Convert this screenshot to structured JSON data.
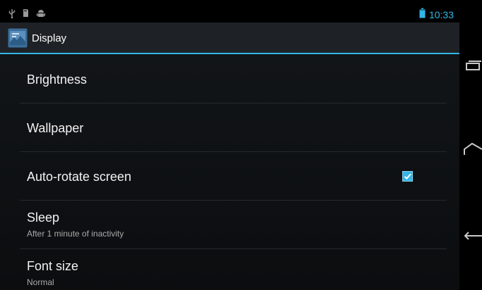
{
  "status_bar": {
    "icons": [
      "usb-icon",
      "sd-card-icon",
      "android-debug-icon"
    ],
    "battery_icon": "battery-icon",
    "time": "10:33"
  },
  "action_bar": {
    "app_icon": "display-settings-icon",
    "title": "Display"
  },
  "settings": [
    {
      "title": "Brightness",
      "summary": ""
    },
    {
      "title": "Wallpaper",
      "summary": ""
    },
    {
      "title": "Auto-rotate screen",
      "summary": "",
      "checked": true
    },
    {
      "title": "Sleep",
      "summary": "After 1 minute of inactivity"
    },
    {
      "title": "Font size",
      "summary": "Normal"
    }
  ],
  "nav_bar": {
    "buttons": [
      "recent-apps-icon",
      "home-icon",
      "back-icon"
    ]
  },
  "colors": {
    "accent": "#33b5e5",
    "background": "#121518",
    "text_primary": "#f2f2f2",
    "text_secondary": "#a9a9a9"
  }
}
